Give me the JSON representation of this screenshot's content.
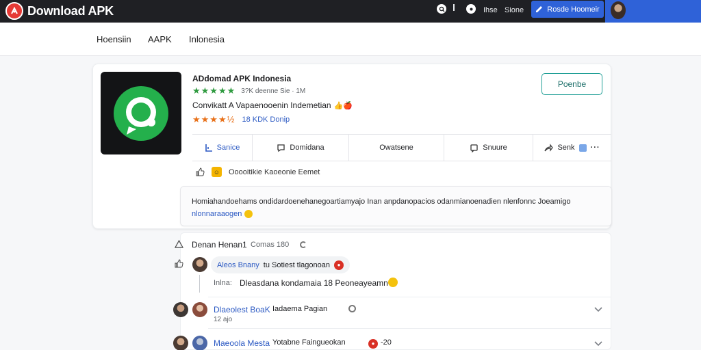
{
  "header": {
    "logo_text": "Download APK",
    "link_1": "Ihse",
    "link_2": "Sione",
    "button_label": "Rosde Hoomeir"
  },
  "subnav": {
    "items": [
      "Hoensiin",
      "AAPK",
      "Inlonesia"
    ]
  },
  "app": {
    "title": "ADdomad APK Indonesia",
    "stats": "3?K deenne Sie · 1M",
    "tagline": "Convikatt A Vapaenooenin Indemetian",
    "tagline_emoji": "👍🍎",
    "rating_count": "18 KDK Donip",
    "follow_label": "Poenbe",
    "star_color": "#2e9a3f",
    "rating_color": "#e8711a"
  },
  "actions": [
    {
      "label": "Sanice",
      "icon": "chart-icon"
    },
    {
      "label": "Domidana",
      "icon": "comment-icon"
    },
    {
      "label": "Owatsene",
      "icon": ""
    },
    {
      "label": "Snuure",
      "icon": "message-icon"
    },
    {
      "label": "Senk",
      "icon": "share-icon"
    }
  ],
  "reaction": {
    "text": "Ooooitikie Kaoeonie Eemet"
  },
  "notice": {
    "line1": "Homiahandoehams ondidardoenehanegoartiamyajo Inan anpdanopacios odanmianoenadien nlenfonnc Joeamigo",
    "line2": "nlonnaraaogen"
  },
  "comments": {
    "header_title": "Denan Henan1",
    "header_count": "Comas 180",
    "items": [
      {
        "name": "Aleos Bnany",
        "text": "tu Sotiest tlagonoan"
      },
      {
        "reply_label": "Inlna:",
        "reply_text": "Dleasdana kondamaia 18 Peoneayeamn"
      },
      {
        "name": "Dlaeolest BoaK",
        "text": "Iadaema Pagian",
        "meta": "12 ajo"
      },
      {
        "name": "Maeoola Mesta",
        "text": "Yotabne Faingueokan",
        "meta": "-20"
      }
    ]
  }
}
